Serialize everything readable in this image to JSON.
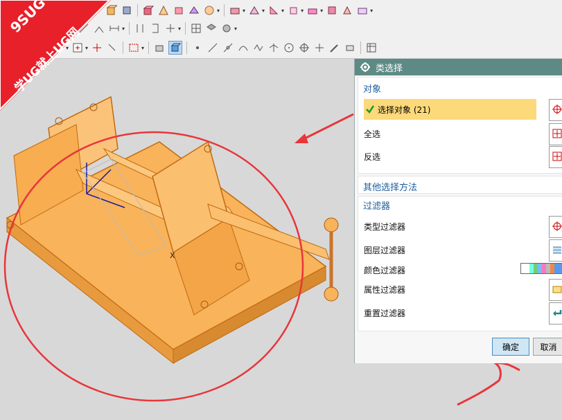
{
  "watermark": {
    "line1": "9SUG",
    "line2": "学UG就上UG网",
    "color": "#e8202a"
  },
  "dialog": {
    "title": "类选择",
    "objects": {
      "header": "对象",
      "select_objects": "选择对象 (21)",
      "select_all": "全选",
      "invert": "反选"
    },
    "other_methods": "其他选择方法",
    "filters": {
      "header": "过滤器",
      "type": "类型过滤器",
      "layer": "图层过滤器",
      "color": "颜色过滤器",
      "attribute": "属性过滤器",
      "reset": "重置过滤器"
    },
    "ok": "确定",
    "cancel": "取消",
    "title_color": "#5e8a85",
    "highlight_color": "#fcd97a"
  },
  "viewport": {
    "axis_label": "X",
    "model_color": "#f9b35a",
    "annotation_color": "#e8353a"
  },
  "icons": {
    "dialog": "gear-icon",
    "check": "checkmark-icon",
    "select": "crosshair-select-icon"
  }
}
